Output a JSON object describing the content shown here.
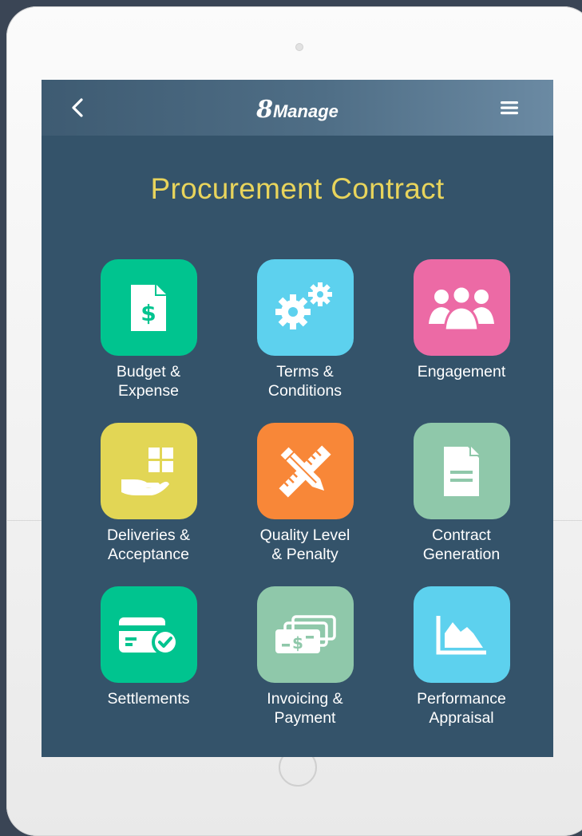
{
  "app": {
    "brand_number": "8",
    "brand_name": "Manage"
  },
  "page": {
    "title": "Procurement Contract"
  },
  "nav": {
    "back_icon": "chevron-left-icon",
    "menu_icon": "hamburger-menu-icon"
  },
  "tiles": [
    {
      "label": "Budget &\nExpense",
      "icon": "dollar-document-icon",
      "color": "#00c48f"
    },
    {
      "label": "Terms &\nConditions",
      "icon": "gears-icon",
      "color": "#5dd1ee"
    },
    {
      "label": "Engagement",
      "icon": "people-group-icon",
      "color": "#ec6aa5"
    },
    {
      "label": "Deliveries &\nAcceptance",
      "icon": "hand-with-boxes-icon",
      "color": "#e2d655"
    },
    {
      "label": "Quality Level\n& Penalty",
      "icon": "pencil-ruler-icon",
      "color": "#f88738"
    },
    {
      "label": "Contract\nGeneration",
      "icon": "document-icon",
      "color": "#8fc8aa"
    },
    {
      "label": "Settlements",
      "icon": "card-check-icon",
      "color": "#00c48f"
    },
    {
      "label": "Invoicing &\nPayment",
      "icon": "cash-bills-icon",
      "color": "#8fc8aa"
    },
    {
      "label": "Performance\nAppraisal",
      "icon": "area-chart-icon",
      "color": "#5dd1ee"
    }
  ]
}
